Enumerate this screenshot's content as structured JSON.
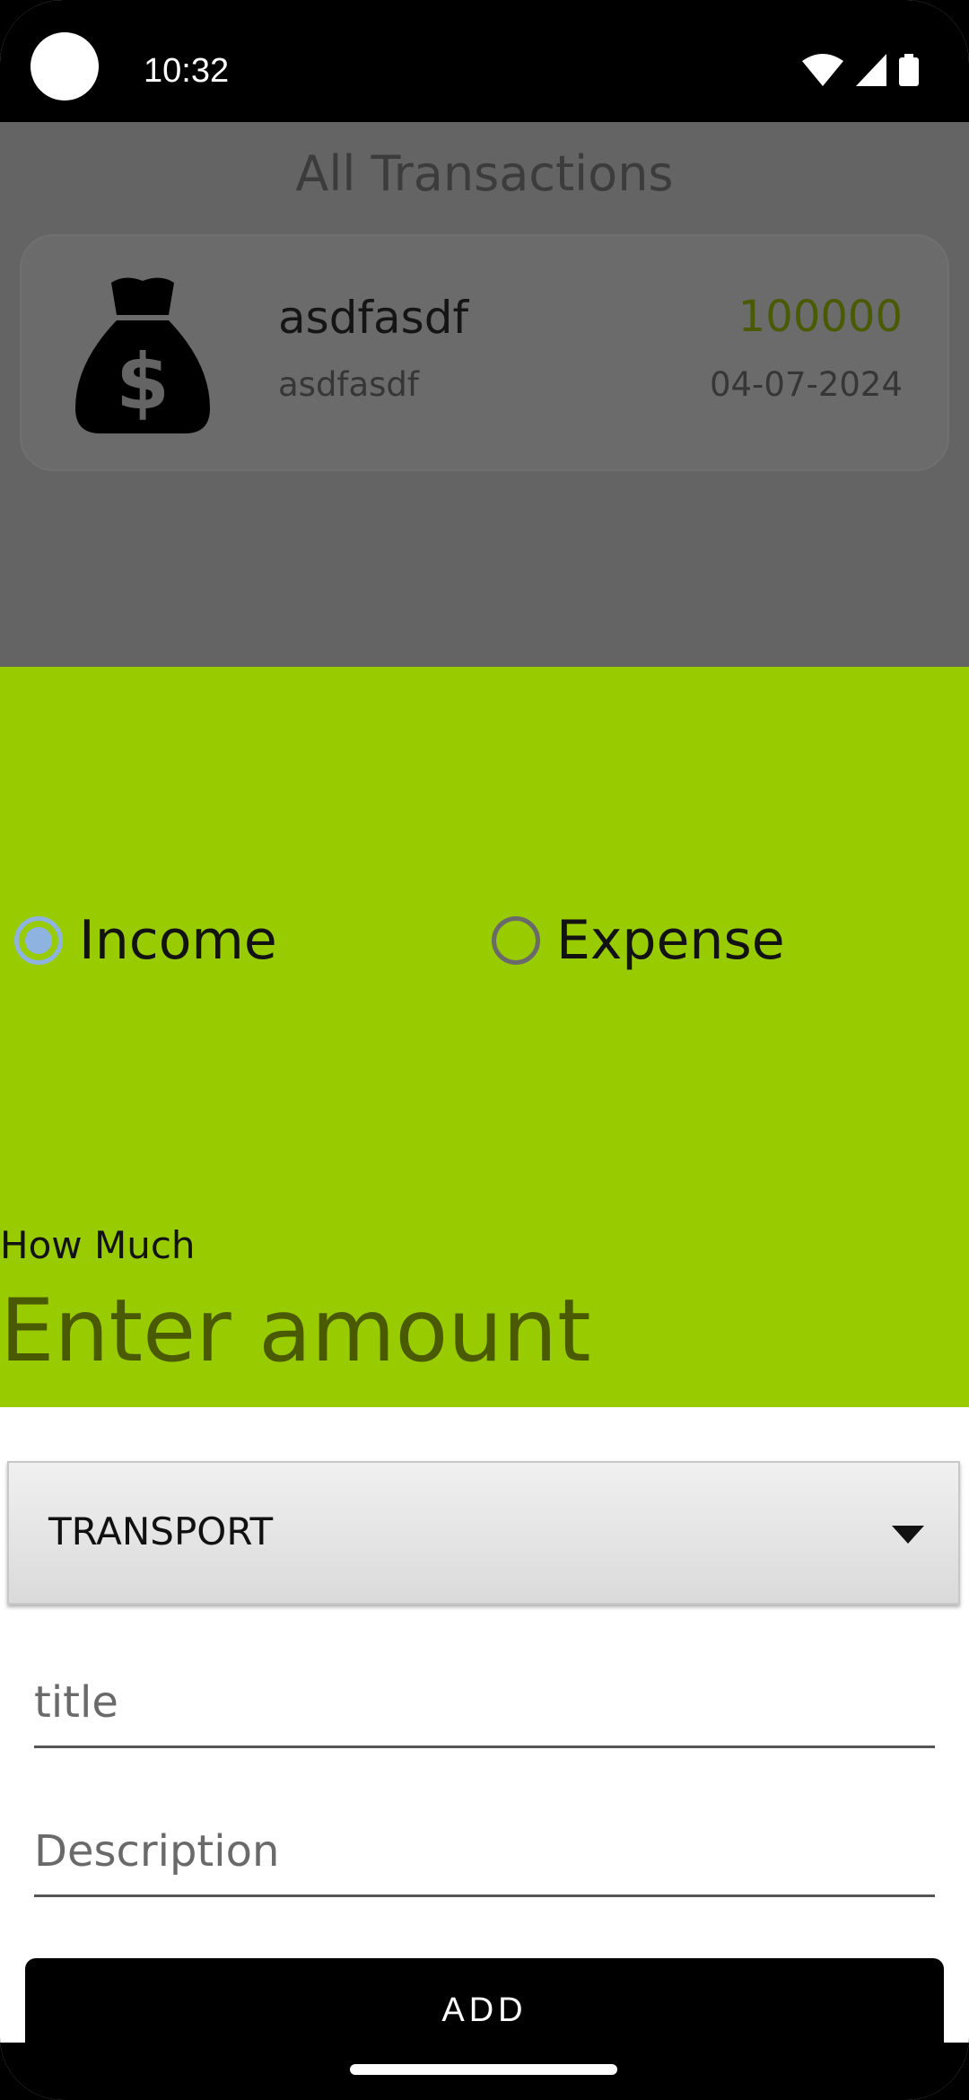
{
  "status_bar": {
    "time": "10:32",
    "icons": [
      "wifi-icon",
      "signal-icon",
      "battery-icon"
    ]
  },
  "list": {
    "title": "All Transactions",
    "transactions": [
      {
        "icon": "money-bag-icon",
        "title": "asdfasdf",
        "description": "asdfasdf",
        "amount": "100000",
        "date": "04-07-2024"
      }
    ]
  },
  "sheet": {
    "background": "#99cc00",
    "type_options": [
      {
        "label": "Income",
        "selected": true
      },
      {
        "label": "Expense",
        "selected": false
      }
    ],
    "amount_label": "How Much",
    "amount_placeholder": "Enter amount"
  },
  "category": {
    "selected": "TRANSPORT"
  },
  "title_field": {
    "placeholder": "title",
    "value": ""
  },
  "description_field": {
    "placeholder": "Description",
    "value": ""
  },
  "add_button": {
    "label": "ADD"
  }
}
